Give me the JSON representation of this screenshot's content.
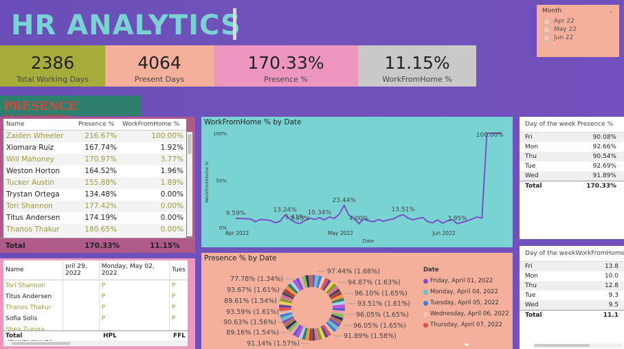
{
  "header": {
    "title": "HR ANALYTICS"
  },
  "month_slicer": {
    "label": "Month",
    "options": [
      "Apr 22",
      "May 22",
      "Jun 22"
    ]
  },
  "kpis": [
    {
      "value": "2386",
      "label": "Total Working Days",
      "color": "#a7ad3a"
    },
    {
      "value": "4064",
      "label": "Present Days",
      "color": "#f4b09b"
    },
    {
      "value": "170.33%",
      "label": "Presence %",
      "color": "#ec96c0"
    },
    {
      "value": "11.15%",
      "label": "WorkFromHome %",
      "color": "#c9c9c9"
    }
  ],
  "section_title": "PRESENCE INSIGHTS",
  "emp_table": {
    "headers": [
      "Name",
      "Presence %",
      "WorkFromHome %"
    ],
    "rows": [
      [
        "Zaiden Wheeler",
        "216.67%",
        "100.00%"
      ],
      [
        "Xiomara Ruiz",
        "167.74%",
        "1.92%"
      ],
      [
        "Will Mahoney",
        "170.97%",
        "3.77%"
      ],
      [
        "Weston Horton",
        "164.52%",
        "1.96%"
      ],
      [
        "Tucker Austin",
        "155.88%",
        "1.89%"
      ],
      [
        "Trystan Ortega",
        "134.48%",
        "0.00%"
      ],
      [
        "Tori Shannon",
        "177.42%",
        "0.00%"
      ],
      [
        "Titus Andersen",
        "174.19%",
        "0.00%"
      ],
      [
        "Thanos Thakur",
        "180.65%",
        "0.00%"
      ]
    ],
    "total": [
      "Total",
      "170.33%",
      "11.15%"
    ]
  },
  "matrix": {
    "headers": [
      "Name",
      "pril 29, 2022",
      "Monday, May 02, 2022",
      "Tues"
    ],
    "rows": [
      [
        "Tori Shannon",
        "",
        "P",
        "P"
      ],
      [
        "Titus Andersen",
        "",
        "P",
        "P"
      ],
      [
        "Thanos Thakur",
        "",
        "P",
        "P"
      ],
      [
        "Sofia Solis",
        "",
        "P",
        "P"
      ],
      [
        "Shea Zuniga",
        "",
        "",
        ""
      ],
      [
        "Samuel Murray",
        "",
        "",
        ""
      ]
    ],
    "total": [
      "Total",
      "",
      "HPL",
      "FFL"
    ]
  },
  "wfh_chart": {
    "title": "WorkFromHome % by Date",
    "xlabel": "Date",
    "ylabel": "WorkFromHome %",
    "yticks": [
      "100%",
      "50%",
      "0%"
    ],
    "xticks": [
      "Apr 2022",
      "May 2022",
      "Jun 2022"
    ],
    "labels": [
      "9.59%",
      "13.24%",
      "5.41%",
      "3.95%",
      "10.34%",
      "23.44%",
      "4.00%",
      "13.51%",
      "3.95%",
      "100.00%"
    ]
  },
  "chart_data": {
    "type": "line",
    "title": "WorkFromHome % by Date",
    "xlabel": "Date",
    "ylabel": "WorkFromHome %",
    "ylim": [
      0,
      100
    ],
    "x": [
      "2022-04-01",
      "2022-04-04",
      "2022-04-05",
      "2022-04-06",
      "2022-04-07",
      "2022-04-08",
      "2022-04-11",
      "2022-04-12",
      "2022-04-13",
      "2022-04-14",
      "2022-04-15",
      "2022-04-18",
      "2022-04-19",
      "2022-04-20",
      "2022-04-21",
      "2022-04-22",
      "2022-04-25",
      "2022-04-26",
      "2022-04-27",
      "2022-04-28",
      "2022-04-29",
      "2022-05-02",
      "2022-05-03",
      "2022-05-04",
      "2022-05-05",
      "2022-05-06",
      "2022-05-09",
      "2022-05-10",
      "2022-05-11",
      "2022-05-12",
      "2022-05-13",
      "2022-05-16",
      "2022-05-17",
      "2022-05-18",
      "2022-05-19",
      "2022-05-20",
      "2022-05-23",
      "2022-05-24",
      "2022-05-25",
      "2022-05-26",
      "2022-05-27",
      "2022-05-30",
      "2022-05-31",
      "2022-06-01",
      "2022-06-02",
      "2022-06-03",
      "2022-06-06",
      "2022-06-07",
      "2022-06-08",
      "2022-06-09",
      "2022-06-10",
      "2022-06-13",
      "2022-06-14",
      "2022-06-15",
      "2022-06-16"
    ],
    "series": [
      {
        "name": "WorkFromHome %",
        "values": [
          9.59,
          9.5,
          9.2,
          9.0,
          6.0,
          8.5,
          8.0,
          7.5,
          5.0,
          6.5,
          13.24,
          9.0,
          5.41,
          3.95,
          7.0,
          10.0,
          8.5,
          10.34,
          8.0,
          11.0,
          9.5,
          14.0,
          23.44,
          13.0,
          10.0,
          4.0,
          9.0,
          7.0,
          6.0,
          8.5,
          6.5,
          8.0,
          9.0,
          12.0,
          13.51,
          10.0,
          8.0,
          9.5,
          10.5,
          6.0,
          5.0,
          8.0,
          4.5,
          7.0,
          8.0,
          3.95,
          5.5,
          7.0,
          9.0,
          11.0,
          10.0,
          100.0,
          100.0,
          100.0,
          100.0
        ]
      }
    ]
  },
  "donut": {
    "title": "Presence % by Date",
    "left_labels": [
      "77.78% (1.34%)",
      "93.67% (1.61%)",
      "89.61% (1.54%)",
      "93.59% (1.61%)",
      "90.63% (1.56%)",
      "89.16% (1.54%)",
      "91.14% (1.57%)"
    ],
    "right_labels": [
      "97.44% (1.68%)",
      "94.87% (1.63%)",
      "96.10% (1.65%)",
      "93.51% (1.61%)",
      "96.05% (1.65%)",
      "96.05% (1.65%)",
      "91.89% (1.58%)"
    ],
    "legend_title": "Date",
    "legend": [
      {
        "label": "Friday, April 01, 2022",
        "color": "#7b4fc9"
      },
      {
        "label": "Monday, April 04, 2022",
        "color": "#5ec4c4"
      },
      {
        "label": "Tuesday, April 05, 2022",
        "color": "#3a7fe0"
      },
      {
        "label": "Wednesday, April 06, 2022",
        "color": "#f7c3b3"
      },
      {
        "label": "Thursday, April 07, 2022",
        "color": "#e05050"
      }
    ]
  },
  "dow_table": {
    "headers": [
      "Day of the week",
      "Presence %"
    ],
    "rows": [
      [
        "Fri",
        "90.08%"
      ],
      [
        "Mon",
        "92.66%"
      ],
      [
        "Thu",
        "90.54%"
      ],
      [
        "Tue",
        "92.69%"
      ],
      [
        "Wed",
        "91.89%"
      ]
    ],
    "total": [
      "Total",
      "170.33%"
    ]
  },
  "dow_wfh_table": {
    "headers": [
      "Day of the week",
      "WorkFromHome"
    ],
    "rows": [
      [
        "Fri",
        "13.8"
      ],
      [
        "Mon",
        "10.0"
      ],
      [
        "Thu",
        "12.8"
      ],
      [
        "Tue",
        "9.3"
      ],
      [
        "Wed",
        "9.5"
      ]
    ],
    "total": [
      "Total",
      "11.1"
    ]
  }
}
